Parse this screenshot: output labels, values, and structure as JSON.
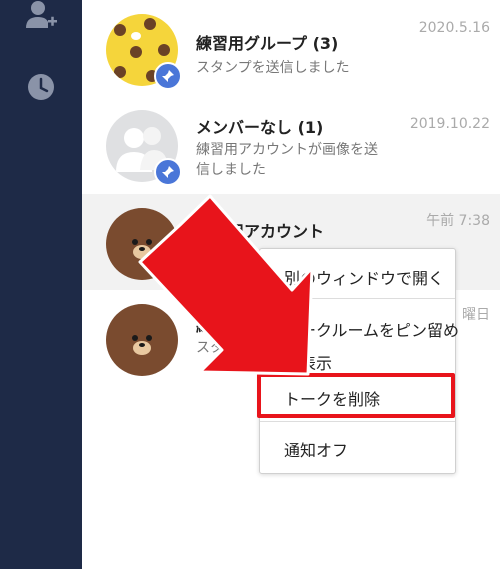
{
  "sidebar": {
    "add_friend_icon": "add-friend-icon",
    "history_icon": "clock-icon"
  },
  "chats": [
    {
      "name": "練習用グループ (3)",
      "preview": "スタンプを送信しました",
      "date": "2020.5.16",
      "pinned": true
    },
    {
      "name": "メンバーなし (1)",
      "preview": "練習用アカウントが画像を送信しました",
      "date": "2019.10.22",
      "pinned": true
    },
    {
      "name": "練習用アカウント",
      "preview": "",
      "date": "午前 7:38",
      "pinned": false
    },
    {
      "name": "練習",
      "preview": "スタンプ",
      "date": "曜日",
      "pinned": false
    }
  ],
  "context_menu": {
    "open_new_window": "別のウィンドウで開く",
    "pin_room": "トークルームをピン留め",
    "hide": "非表示",
    "delete_talk": "トークを削除",
    "notify_off": "通知オフ"
  },
  "colors": {
    "sidebar": "#1e2a47",
    "highlight": "#e8141b",
    "pin": "#4a76d8"
  }
}
